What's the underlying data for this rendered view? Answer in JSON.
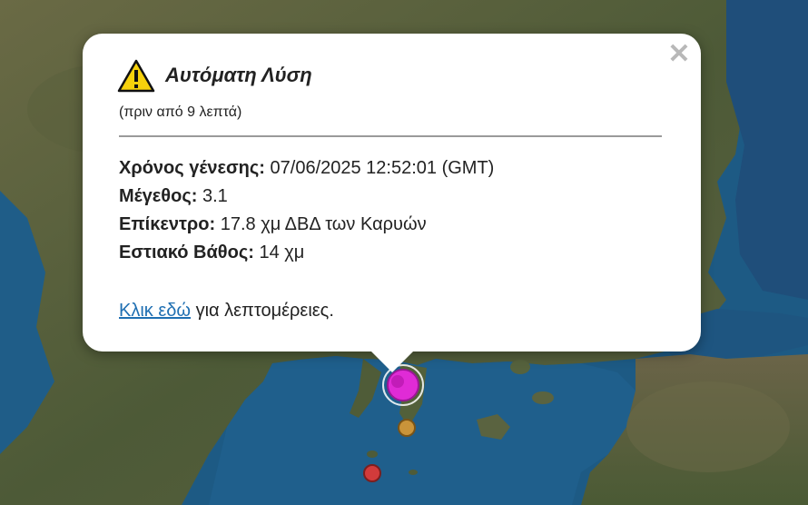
{
  "popup": {
    "title": "Αυτόματη Λύση",
    "subtitle": "(πριν από 9 λεπτά)",
    "close_symbol": "✕",
    "fields": [
      {
        "label": "Χρόνος γένεσης:",
        "value": "07/06/2025 12:52:01 (GMT)"
      },
      {
        "label": "Μέγεθος:",
        "value": "3.1"
      },
      {
        "label": "Επίκεντρο:",
        "value": "17.8 χμ ΔΒΔ των Καρυών"
      },
      {
        "label": "Εστιακό Βάθος:",
        "value": "14 χμ"
      }
    ],
    "link_text": "Κλικ εδώ",
    "link_suffix": " για λεπτομέρειες."
  },
  "markers": [
    {
      "name": "latest-epicenter",
      "color": "#e02bd6"
    },
    {
      "name": "recent-epicenter",
      "color": "#c9943a"
    },
    {
      "name": "older-epicenter",
      "color": "#d23b3b"
    }
  ],
  "icons": {
    "warning": "warning-triangle-icon",
    "close": "close-icon"
  },
  "colors": {
    "sea": "#1d5a84",
    "land": "#4d5a37",
    "warning_yellow": "#f6d10c"
  }
}
